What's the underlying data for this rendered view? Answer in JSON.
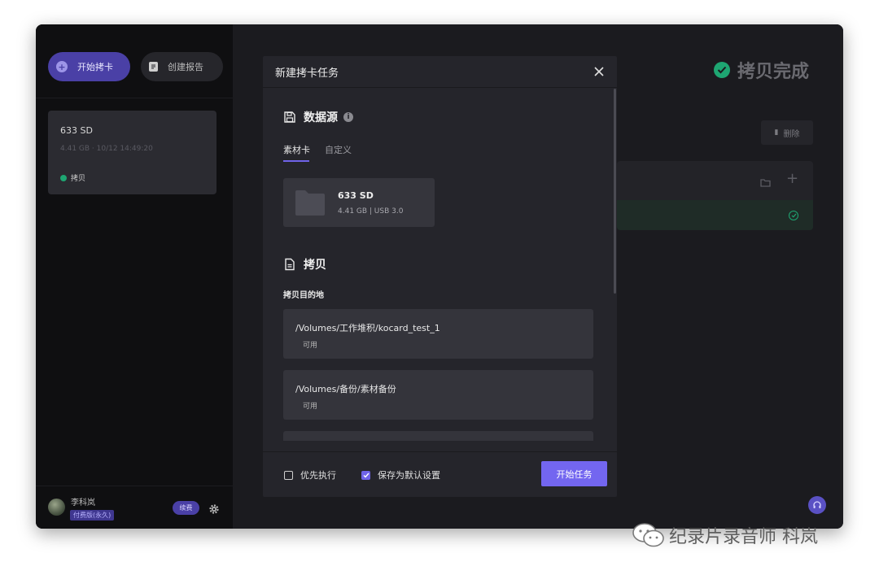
{
  "sidebar": {
    "start_copy_label": "开始拷卡",
    "create_report_label": "创建报告",
    "card": {
      "name": "633 SD",
      "meta": "4.41 GB · 10/12 14:49:20",
      "status": "拷贝"
    },
    "user": {
      "name": "李科岚",
      "plan": "付费版(永久)",
      "renew_label": "续费"
    }
  },
  "main": {
    "status_title": "拷贝完成",
    "delete_label": "删除"
  },
  "modal": {
    "title": "新建拷卡任务",
    "datasource": {
      "title": "数据源",
      "tabs": [
        "素材卡",
        "自定义"
      ],
      "card": {
        "name": "633 SD",
        "detail": "4.41 GB | USB 3.0"
      }
    },
    "copy": {
      "title": "拷贝",
      "dest_label": "拷贝目的地",
      "destinations": [
        {
          "path": "/Volumes/工作堆积/kocard_test_1",
          "status": "可用"
        },
        {
          "path": "/Volumes/备份/素材备份",
          "status": "可用"
        }
      ]
    },
    "footer": {
      "priority_label": "优先执行",
      "priority_checked": false,
      "save_default_label": "保存为默认设置",
      "save_default_checked": true,
      "start_label": "开始任务"
    }
  },
  "watermark": "纪录片录音师 科岚",
  "colors": {
    "accent": "#6f63e8",
    "success": "#1ea672"
  }
}
